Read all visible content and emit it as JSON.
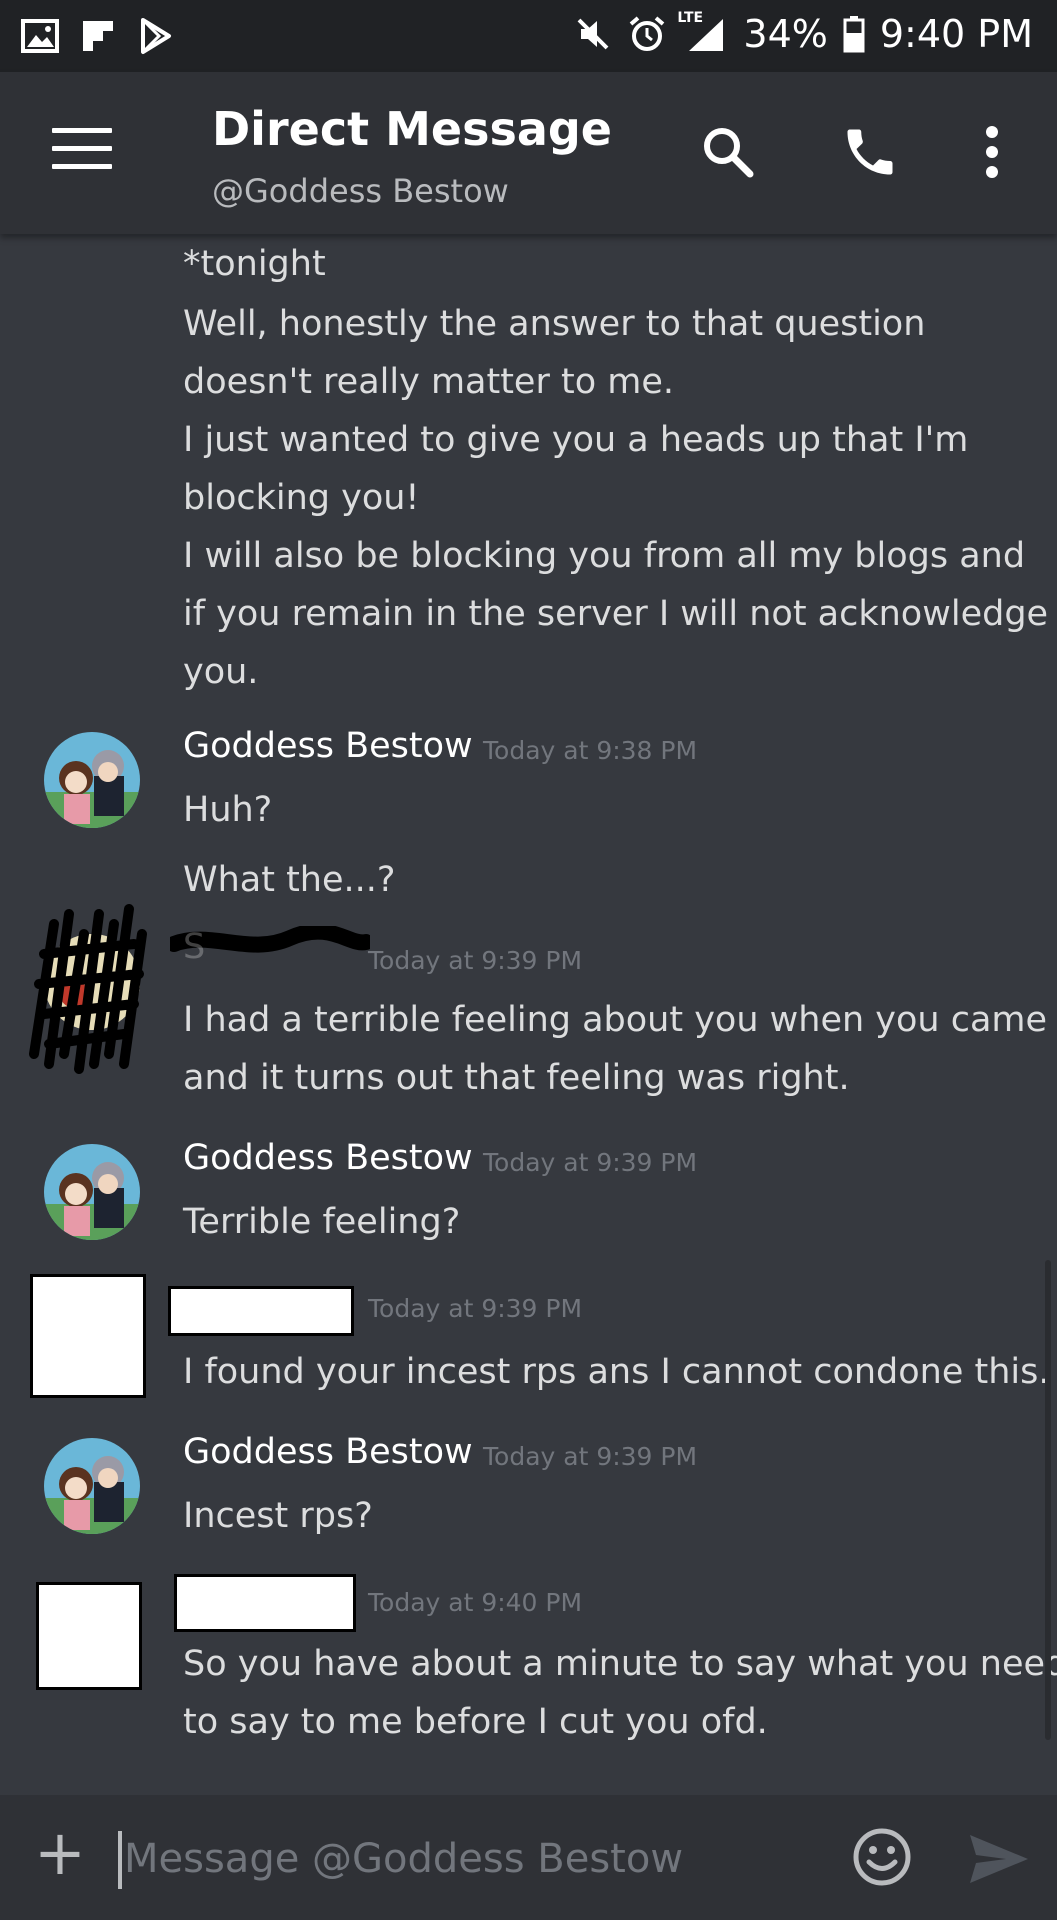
{
  "status_bar": {
    "left_icons": [
      "image-icon",
      "flipboard-icon",
      "play-store-icon"
    ],
    "right_icons": [
      "mute-icon",
      "alarm-icon",
      "lte-signal-icon",
      "battery-icon"
    ],
    "network": "LTE",
    "battery": "34%",
    "time": "9:40 PM"
  },
  "header": {
    "title": "Direct Message",
    "subtitle": "@Goddess Bestow"
  },
  "messages": {
    "continued_lines": [
      "*tonight",
      "Well, honestly the answer to that question",
      "doesn't really matter to me.",
      "I just wanted to give you a heads up that I'm",
      "blocking you!",
      "I will also be blocking you from all my blogs and",
      "if you remain in the server I will not acknowledge",
      "you."
    ],
    "group1": {
      "author": "Goddess Bestow",
      "time": "Today at 9:38 PM",
      "lines": [
        "Huh?",
        "What the...?"
      ]
    },
    "group2": {
      "author": "S",
      "time": "Today at 9:39 PM",
      "lines": [
        "I had a terrible feeling about you when you came",
        "and it turns out that feeling was right."
      ]
    },
    "group3": {
      "author": "Goddess Bestow",
      "time": "Today at 9:39 PM",
      "lines": [
        "Terrible feeling?"
      ]
    },
    "group4": {
      "time": "Today at 9:39 PM",
      "lines": [
        "I found your incest rps ans I cannot condone this."
      ]
    },
    "group5": {
      "author": "Goddess Bestow",
      "time": "Today at 9:39 PM",
      "lines": [
        "Incest rps?"
      ]
    },
    "group6": {
      "time": "Today at 9:40 PM",
      "lines": [
        "So you have about a minute to say what you need",
        "to say to me before I cut you ofd."
      ]
    }
  },
  "input": {
    "placeholder": "Message @Goddess Bestow"
  },
  "colors": {
    "background": "#36393f",
    "header": "#2f3136",
    "status_bar": "#202225",
    "text": "#dcddde",
    "timestamp": "#72767d"
  }
}
